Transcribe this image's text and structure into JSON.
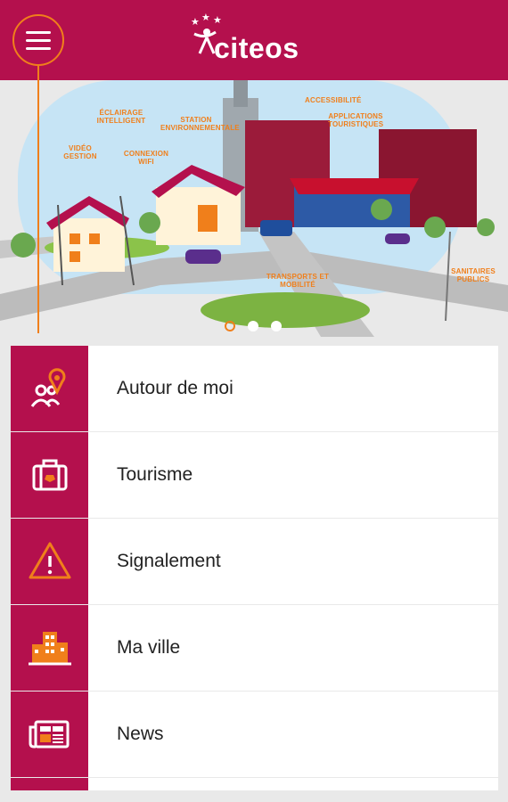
{
  "header": {
    "app_name": "citeos",
    "menu_icon": "hamburger-menu-icon",
    "logo_icon": "citeos-stars-person-logo"
  },
  "banner": {
    "labels": {
      "video": "VIDÉO GESTION",
      "eclairage": "ÉCLAIRAGE INTELLIGENT",
      "wifi": "CONNEXION WIFI",
      "station": "STATION ENVIRONNEMENTALE",
      "accessibilite": "ACCESSIBILITÉ",
      "applications": "APPLICATIONS TOURISTIQUES",
      "transports": "TRANSPORTS ET MOBILITÉ",
      "sanitaires": "SANITAIRES PUBLICS"
    },
    "carousel_pages": 3,
    "active_page": 1
  },
  "menu": {
    "items": [
      {
        "label": "Autour de moi",
        "icon": "people-location-pin-icon"
      },
      {
        "label": "Tourisme",
        "icon": "suitcase-icon"
      },
      {
        "label": "Signalement",
        "icon": "warning-triangle-icon"
      },
      {
        "label": "Ma ville",
        "icon": "city-buildings-icon"
      },
      {
        "label": "News",
        "icon": "newspaper-icon"
      }
    ]
  },
  "colors": {
    "brand": "#b4104d",
    "accent": "#f07f1b"
  }
}
